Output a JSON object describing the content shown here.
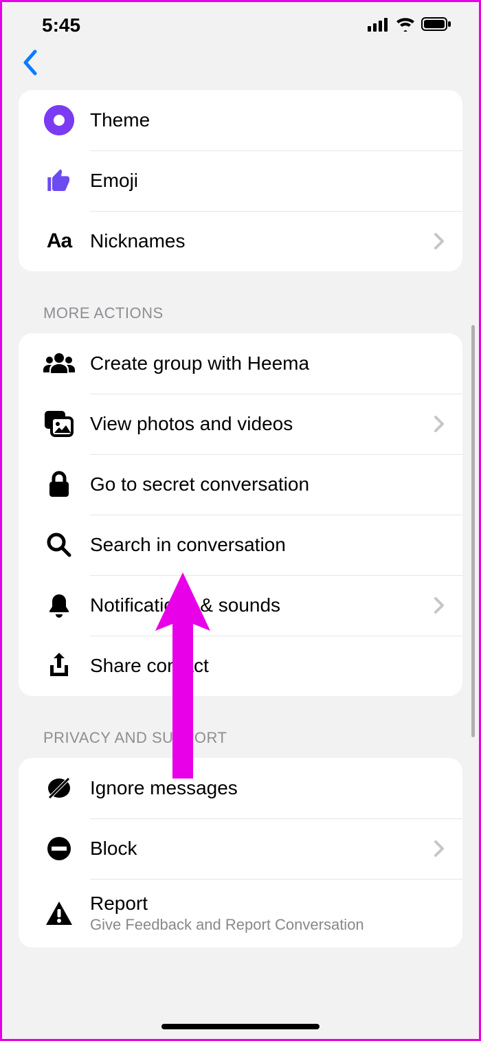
{
  "status": {
    "time": "5:45"
  },
  "group1": {
    "theme": "Theme",
    "emoji": "Emoji",
    "nicknames": "Nicknames"
  },
  "sections": {
    "more": "MORE ACTIONS",
    "privacy": "PRIVACY AND SUPPORT"
  },
  "more": {
    "createGroup": "Create group with Heema",
    "viewPhotos": "View photos and videos",
    "secret": "Go to secret conversation",
    "search": "Search in conversation",
    "notifications": "Notifications & sounds",
    "share": "Share contact"
  },
  "privacy": {
    "ignore": "Ignore messages",
    "block": "Block",
    "report": "Report",
    "reportSub": "Give Feedback and Report Conversation"
  }
}
